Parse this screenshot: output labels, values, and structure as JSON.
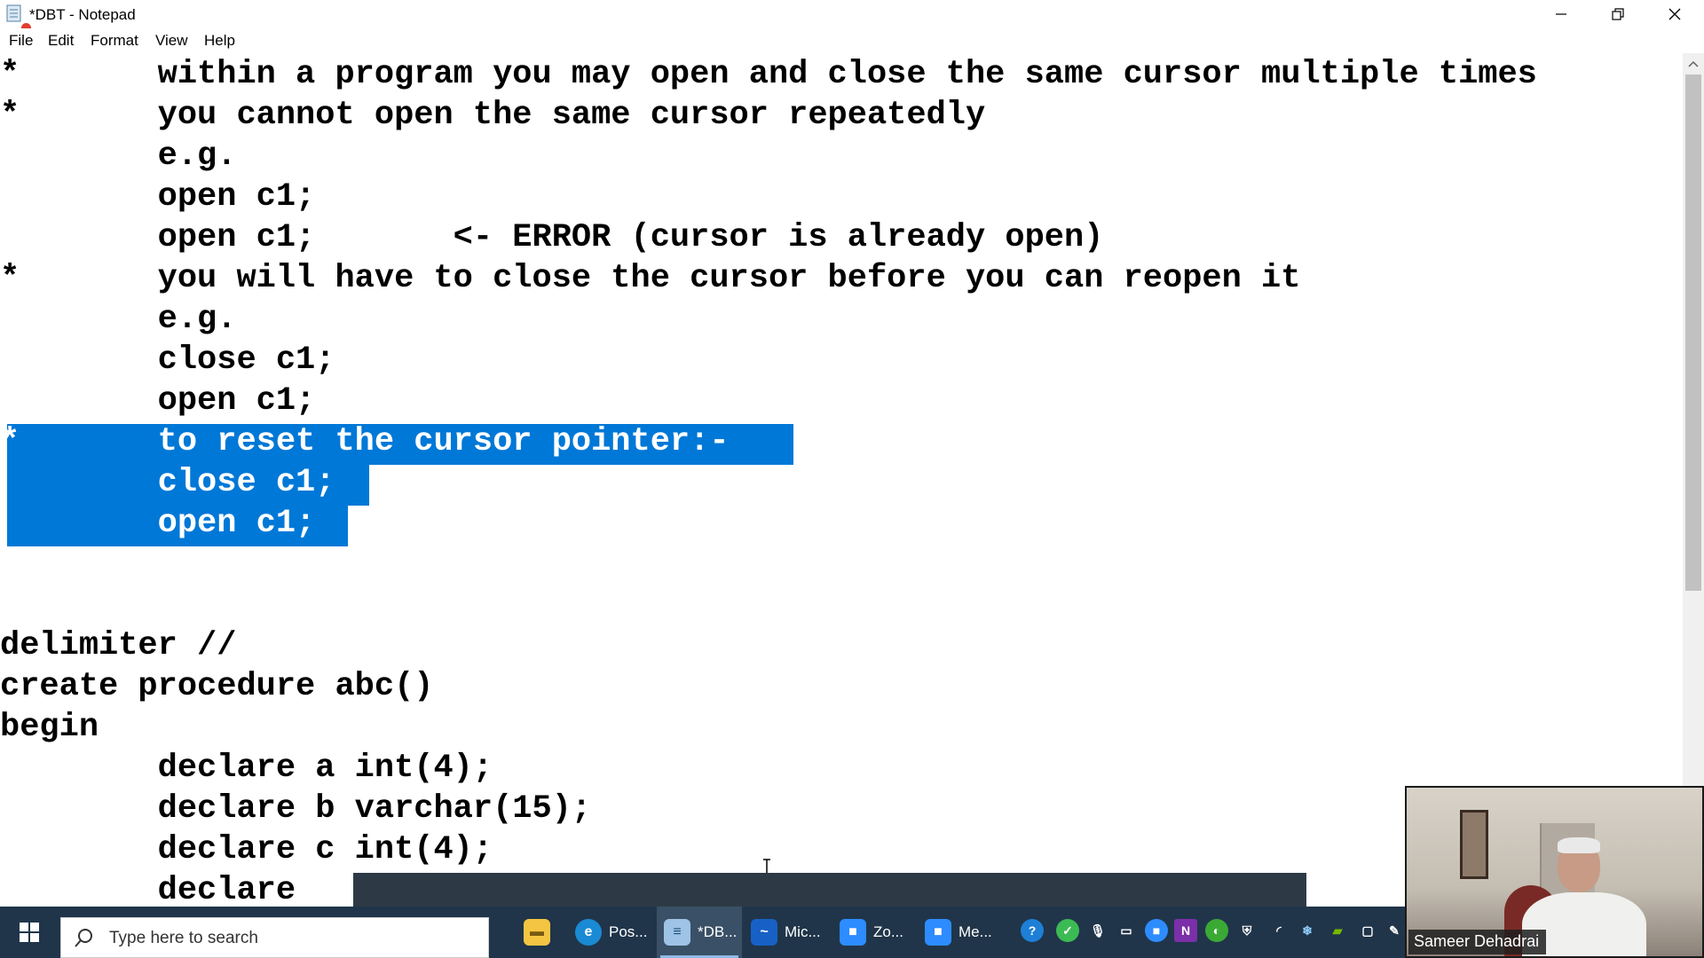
{
  "window": {
    "title": "*DBT - Notepad",
    "colors": {
      "selection": "#0078d7",
      "taskbar": "#20354a"
    }
  },
  "menu": {
    "file": "File",
    "edit": "Edit",
    "format": "Format",
    "view": "View",
    "help": "Help"
  },
  "editor": {
    "lines": [
      "*       within a program you may open and close the same cursor multiple times",
      "*       you cannot open the same cursor repeatedly",
      "        e.g.",
      "        open c1;",
      "        open c1;       <- ERROR (cursor is already open)",
      "*       you will have to close the cursor before you can reopen it",
      "        e.g.",
      "        close c1;",
      "        open c1;",
      "*       to reset the cursor pointer:-",
      "        close c1;",
      "        open c1;",
      "",
      "",
      "delimiter //",
      "create procedure abc()",
      "begin",
      "        declare a int(4);",
      "        declare b varchar(15);",
      "        declare c int(4);",
      "        declare"
    ],
    "selected_lines": [
      9,
      10,
      11
    ]
  },
  "taskbar": {
    "search_placeholder": "Type here to search",
    "apps": [
      {
        "label": "Pos...",
        "icon": "edge-icon"
      },
      {
        "label": "*DB...",
        "icon": "notepad-icon"
      },
      {
        "label": "Mic...",
        "icon": "whiteboard-icon"
      },
      {
        "label": "Zo...",
        "icon": "zoom-icon"
      },
      {
        "label": "Me...",
        "icon": "zoom-meeting-icon"
      }
    ]
  },
  "video": {
    "participant_name": "Sameer Dehadrai"
  }
}
